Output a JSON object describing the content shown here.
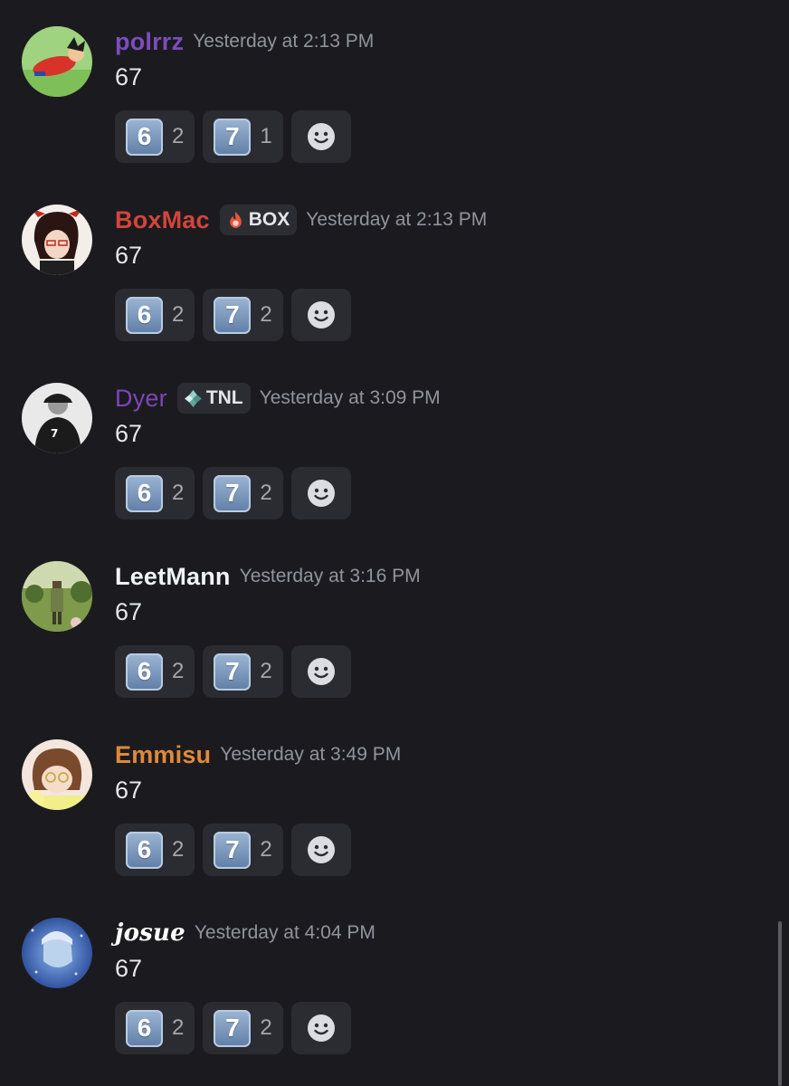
{
  "messages": [
    {
      "username": "polrrz",
      "username_color": "#7c4dbd",
      "tag": null,
      "timestamp": "Yesterday at 2:13 PM",
      "text": "67",
      "reactions": [
        {
          "emoji": "6",
          "count": "2"
        },
        {
          "emoji": "7",
          "count": "1"
        }
      ]
    },
    {
      "username": "BoxMac",
      "username_color": "#d4443b",
      "tag": {
        "label": "BOX",
        "icon": "fire-icon"
      },
      "timestamp": "Yesterday at 2:13 PM",
      "text": "67",
      "reactions": [
        {
          "emoji": "6",
          "count": "2"
        },
        {
          "emoji": "7",
          "count": "2"
        }
      ]
    },
    {
      "username": "Dyer",
      "username_color": "#7d46b8",
      "tag": {
        "label": "TNL",
        "icon": "diamond-icon"
      },
      "timestamp": "Yesterday at 3:09 PM",
      "text": "67",
      "reactions": [
        {
          "emoji": "6",
          "count": "2"
        },
        {
          "emoji": "7",
          "count": "2"
        }
      ]
    },
    {
      "username": "LeetMann",
      "username_color": "#f2f3f5",
      "tag": null,
      "timestamp": "Yesterday at 3:16 PM",
      "text": "67",
      "reactions": [
        {
          "emoji": "6",
          "count": "2"
        },
        {
          "emoji": "7",
          "count": "2"
        }
      ]
    },
    {
      "username": "Emmisu",
      "username_color": "#e0893a",
      "tag": null,
      "timestamp": "Yesterday at 3:49 PM",
      "text": "67",
      "reactions": [
        {
          "emoji": "6",
          "count": "2"
        },
        {
          "emoji": "7",
          "count": "2"
        }
      ]
    },
    {
      "username": "josue",
      "username_color": "#ffffff",
      "tag": null,
      "timestamp": "Yesterday at 4:04 PM",
      "text": "67",
      "reactions": [
        {
          "emoji": "6",
          "count": "2"
        },
        {
          "emoji": "7",
          "count": "2"
        }
      ]
    }
  ],
  "icons": {
    "add_reaction": "smile-icon"
  }
}
